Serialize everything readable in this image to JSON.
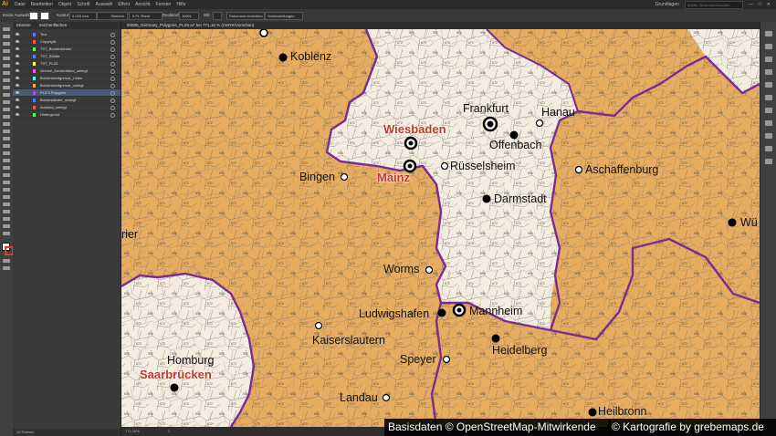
{
  "app": {
    "logo": "Ai"
  },
  "menu": [
    "Datei",
    "Bearbeiten",
    "Objekt",
    "Schrift",
    "Auswahl",
    "Effekt",
    "Ansicht",
    "Fenster",
    "Hilfe"
  ],
  "workspace": {
    "label": "Grundlagen",
    "search_placeholder": "Adobe Stock durchsuchen"
  },
  "controlbar": {
    "selection": "Keine Auswahl",
    "stroke_label": "Kontur:",
    "stroke_value": "0,025 mm",
    "style": "Gleichm.",
    "brush": "5 Pt. Rund",
    "opacity_label": "Deckkraft:",
    "opacity_value": "100%",
    "style_label": "Stil:",
    "doc_setup": "Dokument einrichten",
    "prefs": "Voreinstellungen"
  },
  "layers_panel": {
    "tabs": [
      "Ebenen",
      "Zeichenflächen"
    ],
    "layers": [
      {
        "name": "Text",
        "color": "#4f7fff"
      },
      {
        "name": "Copyright",
        "color": "#ff4f4f"
      },
      {
        "name": "TXT_Bundesländer",
        "color": "#4fff4f"
      },
      {
        "name": "TXT_Städte",
        "color": "#4f7fff"
      },
      {
        "name": "TXT_PLZ5",
        "color": "#ffff4f"
      },
      {
        "name": "Grenze_Deutschland_umlegt",
        "color": "#ff4fff"
      },
      {
        "name": "Bundeslandgrenze_Linien",
        "color": "#4fffff"
      },
      {
        "name": "Bundeslandgrenze_umlegt",
        "color": "#ff9f4f"
      },
      {
        "name": "PLZ 5 Polygone",
        "color": "#9f4fff"
      },
      {
        "name": "Bundesländer_umlegt",
        "color": "#4f7fff"
      },
      {
        "name": "Ausland_umlegt",
        "color": "#ff4f4f"
      },
      {
        "name": "Hintergrund",
        "color": "#4fff4f"
      }
    ],
    "footer": "12 Ebenen"
  },
  "document_tab": "50000_Germany_Polygone_PLZ5.ai* bei 771,16 % (CMYK/Vorschau)",
  "status": {
    "zoom": "771,16%",
    "page": "1"
  },
  "map": {
    "colors": {
      "land": "#e6ac60",
      "highlight": "#f5ece0",
      "border": "#7b2d8e",
      "capital": "#c0392b"
    },
    "capitals": [
      "Wiesbaden",
      "Mainz",
      "Saarbrücken"
    ],
    "cities": [
      "Koblenz",
      "Frankfurt",
      "Hanau",
      "Offenbach",
      "Rüsselsheim",
      "Aschaffenburg",
      "Bingen",
      "Darmstadt",
      "Würzburg",
      "Trier",
      "Worms",
      "Mannheim",
      "Ludwigshafen",
      "Kaiserslautern",
      "Heidelberg",
      "Homburg",
      "Speyer",
      "Landau",
      "Heilbronn"
    ],
    "city_labels_shown": {
      "wuerzburg": "Wü",
      "trier": "rier"
    }
  },
  "credits": {
    "left": "Basisdaten © OpenStreetMap-Mitwirkende",
    "right": "© Kartografie by grebemaps.de"
  }
}
